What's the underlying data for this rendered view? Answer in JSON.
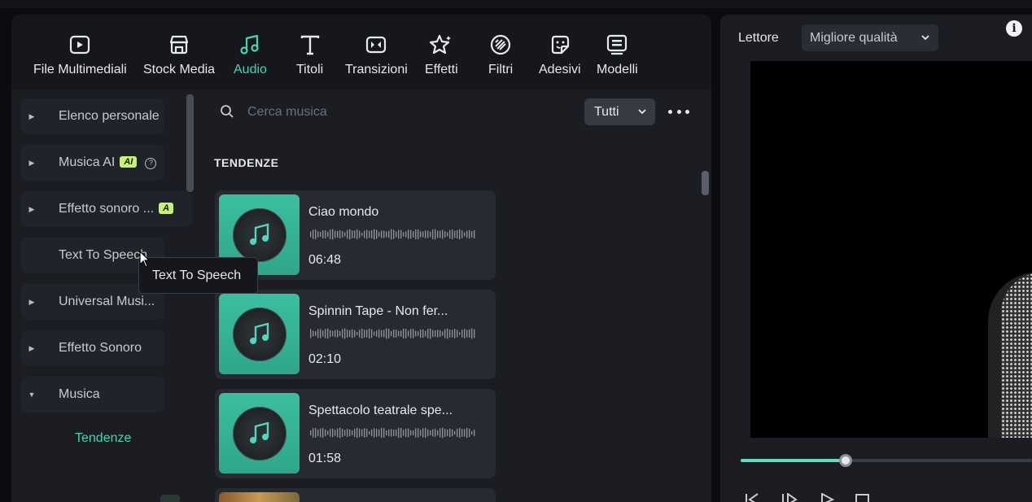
{
  "toolbar": {
    "items": [
      {
        "label": "File Multimediali",
        "icon": "media-file-icon",
        "active": false
      },
      {
        "label": "Stock Media",
        "icon": "stock-media-icon",
        "active": false
      },
      {
        "label": "Audio",
        "icon": "music-note-icon",
        "active": true
      },
      {
        "label": "Titoli",
        "icon": "text-title-icon",
        "active": false
      },
      {
        "label": "Transizioni",
        "icon": "transition-icon",
        "active": false
      },
      {
        "label": "Effetti",
        "icon": "effects-sparkle-icon",
        "active": false
      },
      {
        "label": "Filtri",
        "icon": "filter-icon",
        "active": false
      },
      {
        "label": "Adesivi",
        "icon": "sticker-icon",
        "active": false
      },
      {
        "label": "Modelli",
        "icon": "template-icon",
        "active": false
      }
    ]
  },
  "sidebar": {
    "items": [
      {
        "label": "Elenco personale",
        "expanded": false
      },
      {
        "label": "Musica AI",
        "badge": "AI",
        "help": "?",
        "expanded": false
      },
      {
        "label": "Effetto sonoro ...",
        "badge": "A",
        "expanded": false
      },
      {
        "label": "Text To Speech",
        "expanded": false
      },
      {
        "label": "Universal Musi...",
        "expanded": false
      },
      {
        "label": "Effetto Sonoro",
        "expanded": false
      },
      {
        "label": "Musica",
        "expanded": true
      }
    ],
    "sub_item": "Tendenze"
  },
  "search": {
    "placeholder": "Cerca musica",
    "value": ""
  },
  "filter": {
    "selected": "Tutti"
  },
  "section_title": "TENDENZE",
  "tracks": [
    {
      "title": "Ciao mondo",
      "duration": "06:48"
    },
    {
      "title": "Spinnin Tape - Non fer...",
      "duration": "02:10"
    },
    {
      "title": "Spettacolo teatrale spe...",
      "duration": "01:58"
    }
  ],
  "tooltip": "Text To Speech",
  "player": {
    "label": "Lettore",
    "quality": "Migliore qualità",
    "info": "i",
    "progress": 0.36
  },
  "colors": {
    "accent": "#3fd8b3",
    "panel": "#1b1d22",
    "card": "#272a31"
  }
}
